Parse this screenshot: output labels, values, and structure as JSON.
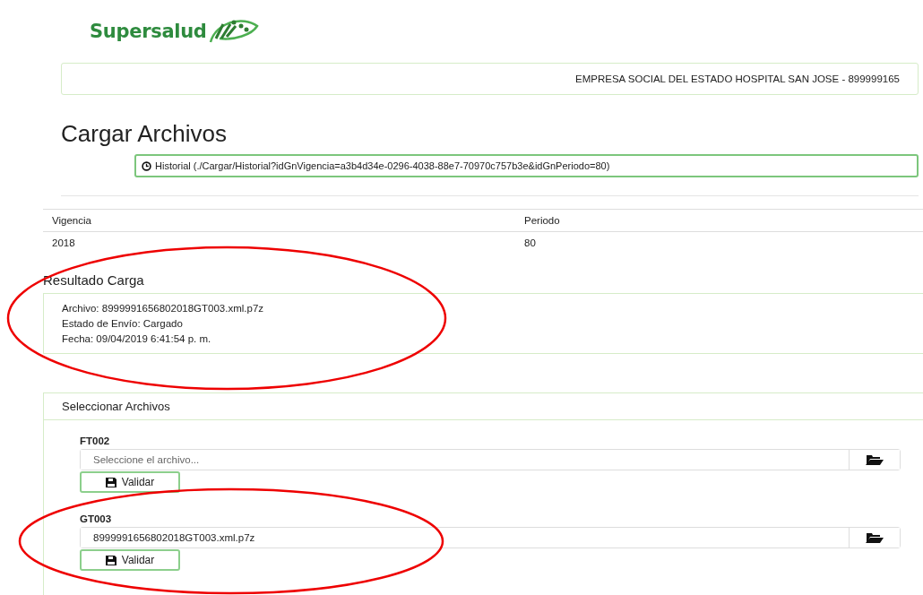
{
  "logo": {
    "text": "Supersalud"
  },
  "company": "EMPRESA SOCIAL DEL ESTADO HOSPITAL SAN JOSE - 899999165",
  "title": "Cargar Archivos",
  "history_link": "Historial (./Cargar/Historial?idGnVigencia=a3b4d34e-0296-4038-88e7-70970c757b3e&idGnPeriodo=80)",
  "table": {
    "columns": [
      "Vigencia",
      "Periodo"
    ],
    "rows": [
      [
        "2018",
        "80"
      ]
    ]
  },
  "result": {
    "title": "Resultado Carga",
    "lines": [
      "Archivo: 8999991656802018GT003.xml.p7z",
      "Estado de Envío: Cargado",
      "Fecha: 09/04/2019 6:41:54 p. m."
    ]
  },
  "select": {
    "title": "Seleccionar Archivos",
    "files": [
      {
        "label": "FT002",
        "placeholder": "Seleccione el archivo...",
        "button": "Validar"
      },
      {
        "label": "GT003",
        "value": "8999991656802018GT003.xml.p7z",
        "button": "Validar"
      }
    ]
  }
}
